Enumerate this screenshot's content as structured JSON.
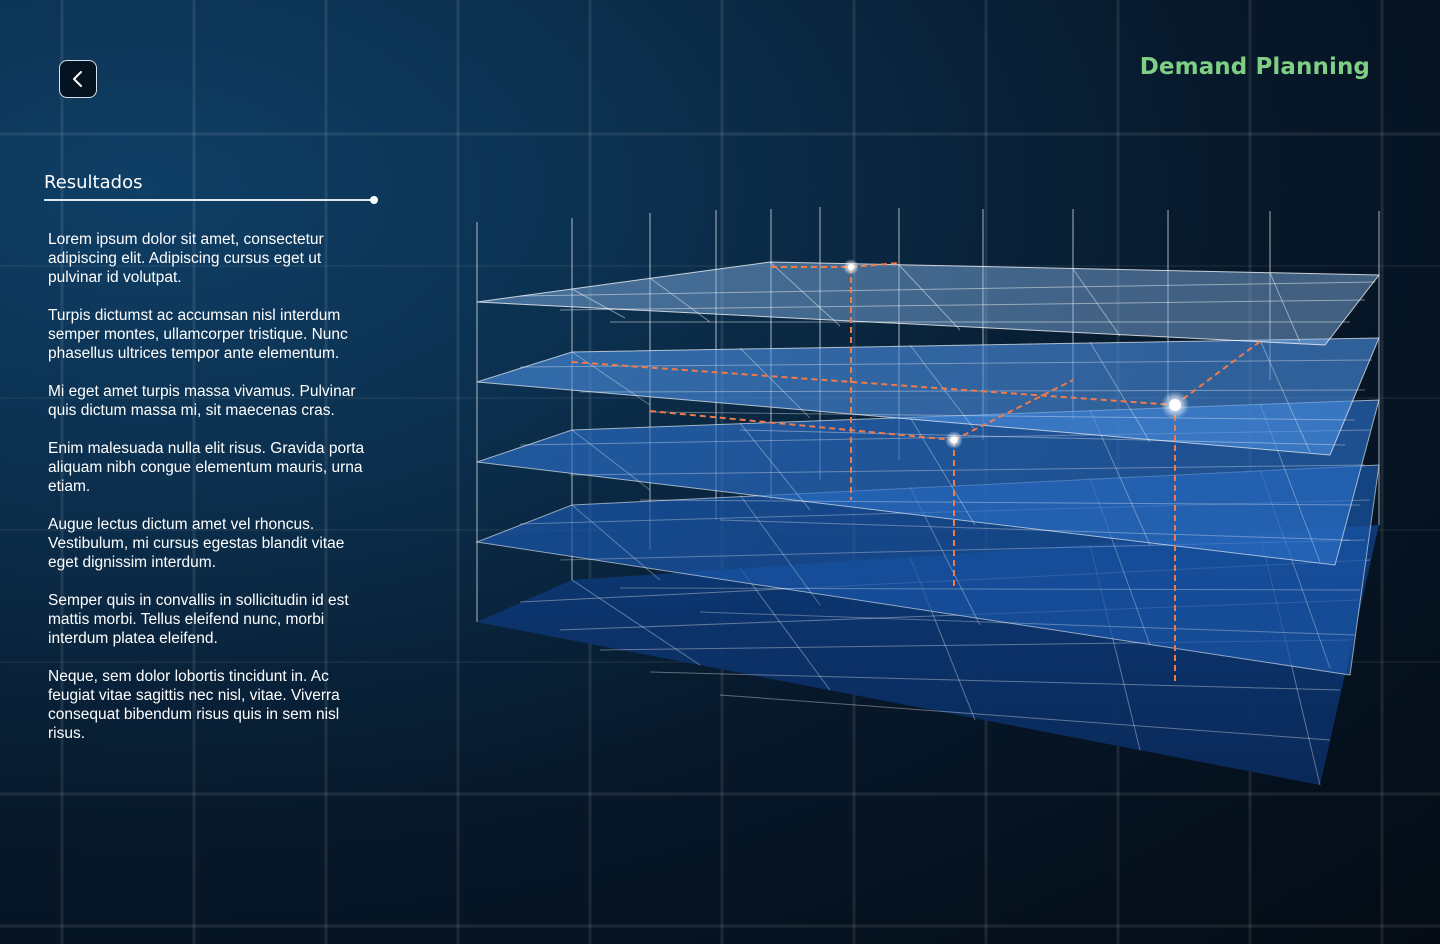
{
  "header": {
    "title": "Demand Planning",
    "back_icon": "chevron-left-icon"
  },
  "results": {
    "heading": "Resultados",
    "paragraphs": [
      "Lorem ipsum dolor sit amet, consectetur adipiscing elit. Adipiscing cursus eget ut pulvinar id volutpat.",
      "Turpis dictumst ac accumsan nisl interdum semper montes, ullamcorper tristique. Nunc phasellus ultrices tempor ante elementum.",
      "Mi eget amet turpis massa vivamus. Pulvinar quis dictum massa mi, sit maecenas cras.",
      "Enim malesuada nulla elit risus. Gravida porta aliquam nibh congue elementum mauris, urna etiam.",
      "Augue lectus dictum amet vel rhoncus. Vestibulum, mi cursus egestas blandit vitae eget dignissim interdum.",
      "Semper quis in convallis in sollicitudin id est mattis morbi. Tellus eleifend nunc, morbi interdum platea eleifend.",
      "Neque, sem dolor lobortis tincidunt in. Ac feugiat vitae sagittis nec nisl, vitae. Viverra consequat bibendum risus quis in sem nisl risus."
    ]
  },
  "colors": {
    "title_accent": "#7fce86",
    "highlight_line": "#f07a4a",
    "layer_fill": "#3b7fd0",
    "background_dark": "#040b14"
  },
  "visualization": {
    "layer_count": 5,
    "marker_points": 3
  }
}
